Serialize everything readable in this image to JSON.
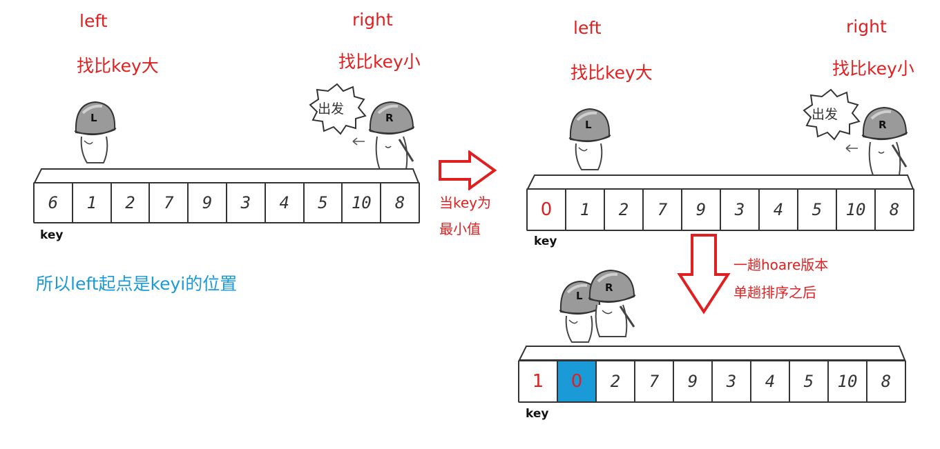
{
  "diagram1": {
    "left_label": "left",
    "left_desc": "找比key大",
    "right_label": "right",
    "right_desc": "找比key小",
    "bubble_text": "出发",
    "helmet_left": "L",
    "helmet_right": "R",
    "array": [
      "6",
      "1",
      "2",
      "7",
      "9",
      "3",
      "4",
      "5",
      "10",
      "8"
    ],
    "key_label": "key",
    "note": "所以left起点是keyi的位置"
  },
  "arrow_note": [
    "当key为",
    "最小值"
  ],
  "diagram2": {
    "left_label": "left",
    "left_desc": "找比key大",
    "right_label": "right",
    "right_desc": "找比key小",
    "bubble_text": "出发",
    "helmet_left": "L",
    "helmet_right": "R",
    "array": [
      "0",
      "1",
      "2",
      "7",
      "9",
      "3",
      "4",
      "5",
      "10",
      "8"
    ],
    "key_label": "key"
  },
  "down_note": [
    "一趟hoare版本",
    "单趟排序之后"
  ],
  "diagram3": {
    "helmet_left": "L",
    "helmet_right": "R",
    "array": [
      "1",
      "0",
      "2",
      "7",
      "9",
      "3",
      "4",
      "5",
      "10",
      "8"
    ],
    "key_label": "key"
  },
  "colors": {
    "accent_red": "#e02020",
    "accent_blue": "#1a9ad6",
    "outline": "#333333"
  }
}
